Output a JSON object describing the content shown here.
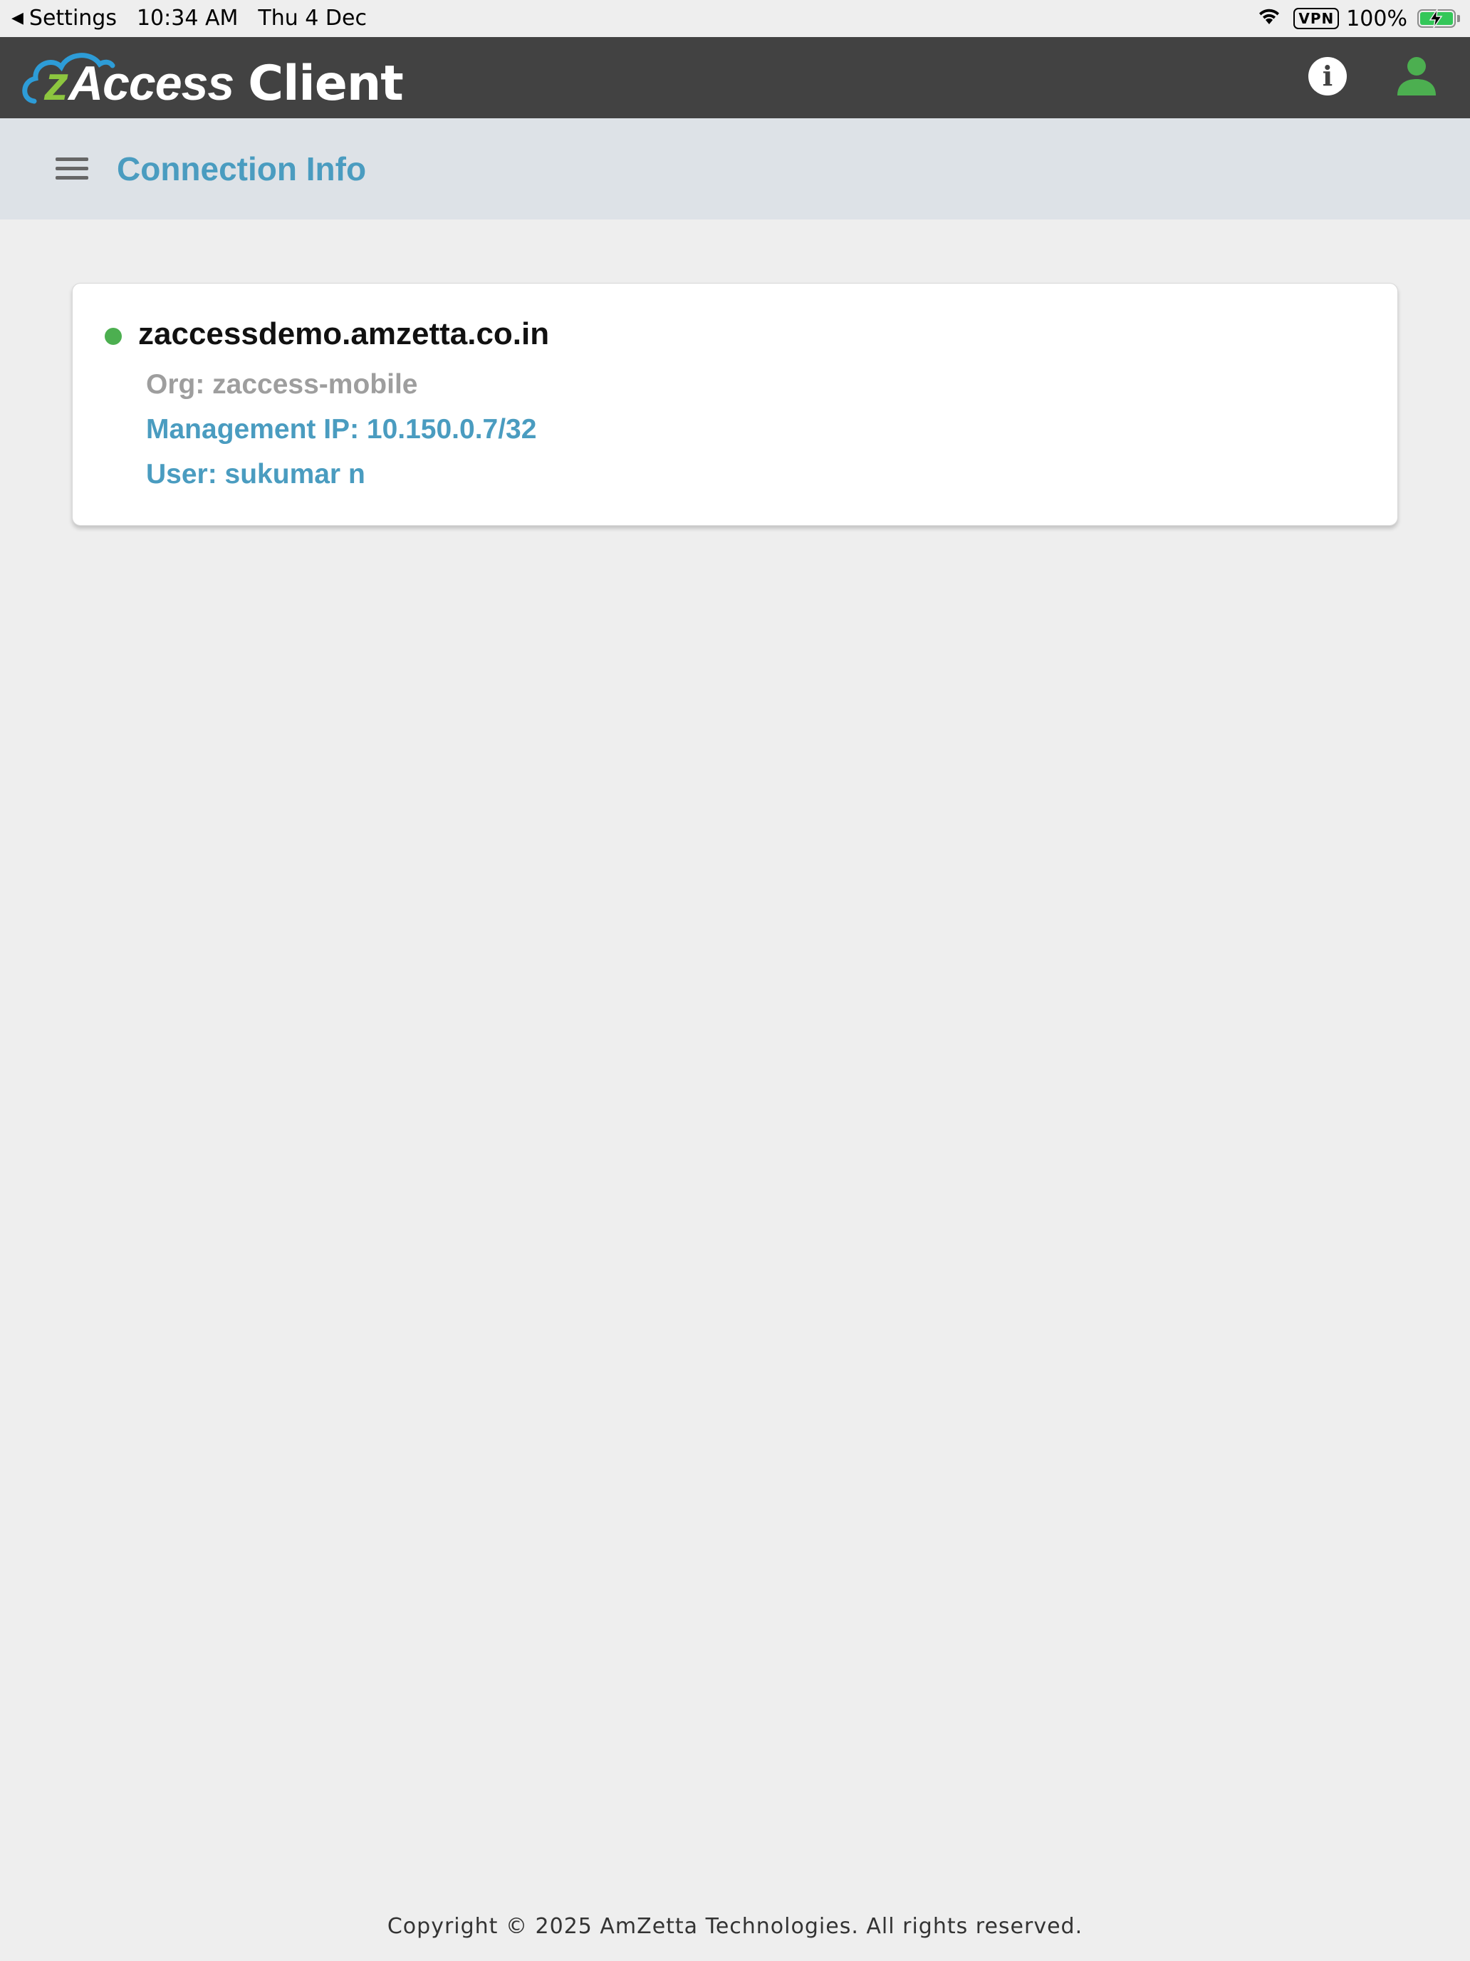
{
  "status_bar": {
    "back_label": "Settings",
    "time": "10:34 AM",
    "date": "Thu 4 Dec",
    "vpn_label": "VPN",
    "battery_percent": "100%",
    "battery_level": 1.0,
    "icons": {
      "back": "back-arrow-icon",
      "wifi": "wifi-icon",
      "battery": "battery-charging-icon"
    }
  },
  "header": {
    "logo": {
      "z": "z",
      "access": "Access",
      "client": "Client"
    },
    "icons": {
      "info": "info-icon",
      "account": "user-icon"
    }
  },
  "sub_header": {
    "title": "Connection Info",
    "menu_icon": "hamburger-menu-icon"
  },
  "connection": {
    "server": "zaccessdemo.amzetta.co.in",
    "org": "Org: zaccess-mobile",
    "management_ip": "Management IP: 10.150.0.7/32",
    "user": "User: sukumar n",
    "status": "connected"
  },
  "footer": {
    "copyright": "Copyright © 2025 AmZetta Technologies. All rights reserved."
  },
  "colors": {
    "header_bg": "#424242",
    "sub_header_bg": "#dde2e7",
    "page_bg": "#eeeeee",
    "accent_blue": "#4a9cc0",
    "logo_green": "#8dc63f",
    "logo_cloud_blue": "#2d9cd7",
    "status_green": "#4caf50",
    "account_icon_green": "#4caf50",
    "muted_text": "#9e9e9e"
  }
}
